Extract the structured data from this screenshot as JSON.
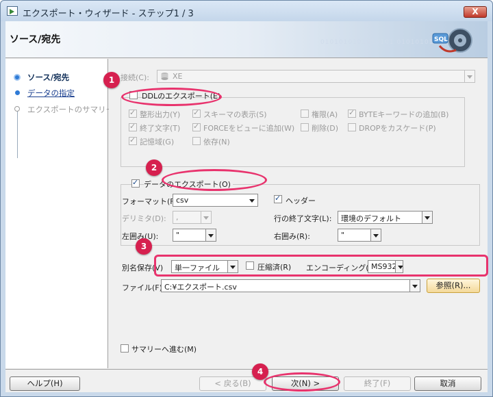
{
  "window": {
    "title": "エクスポート・ウィザード - ステップ1 / 3",
    "close_label": "X"
  },
  "header": {
    "title": "ソース/宛先",
    "binary_text": "0101010101010101 01010101010",
    "logo_text": "SQL"
  },
  "nav": {
    "items": [
      {
        "label": "ソース/宛先",
        "state": "current"
      },
      {
        "label": "データの指定",
        "state": "link"
      },
      {
        "label": "エクスポートのサマリー",
        "state": "disabled"
      }
    ]
  },
  "connection": {
    "label": "接続(C):",
    "value": "XE"
  },
  "ddl": {
    "label": "DDLのエクスポート(E)",
    "checked": false,
    "options": [
      {
        "label": "整形出力(Y)",
        "checked": true
      },
      {
        "label": "スキーマの表示(S)",
        "checked": true
      },
      {
        "label": "権限(A)",
        "checked": false
      },
      {
        "label": "BYTEキーワードの追加(B)",
        "checked": true
      },
      {
        "label": "終了文字(T)",
        "checked": true
      },
      {
        "label": "FORCEをビューに追加(W)",
        "checked": true
      },
      {
        "label": "削除(D)",
        "checked": false
      },
      {
        "label": "DROPをカスケード(P)",
        "checked": false
      },
      {
        "label": "記憶域(G)",
        "checked": true
      },
      {
        "label": "依存(N)",
        "checked": false
      }
    ]
  },
  "data_export": {
    "label": "データのエクスポート(O)",
    "checked": true,
    "format_label": "フォーマット(F):",
    "format_value": "csv",
    "header_label": "ヘッダー",
    "header_checked": true,
    "delimiter_label": "デリミタ(D):",
    "delimiter_value": ",",
    "line_term_label": "行の終了文字(L):",
    "line_term_value": "環境のデフォルト",
    "left_enclosure_label": "左囲み(U):",
    "left_enclosure_value": "\"",
    "right_enclosure_label": "右囲み(R):",
    "right_enclosure_value": "\""
  },
  "output": {
    "save_as_label": "別名保存(V)",
    "save_as_value": "単一ファイル",
    "compress_label": "圧縮済(R)",
    "compress_checked": false,
    "encoding_label": "エンコーディング(I):",
    "encoding_value": "MS932",
    "file_label": "ファイル(F):",
    "file_value": "C:¥エクスポート.csv",
    "browse_label": "参照(R)..."
  },
  "summary": {
    "label": "サマリーへ進む(M)",
    "checked": false
  },
  "footer": {
    "help": "ヘルプ(H)",
    "back": "< 戻る(B)",
    "next": "次(N) >",
    "finish": "終了(F)",
    "cancel": "取消"
  },
  "annotations": {
    "badges": [
      "1",
      "2",
      "3",
      "4"
    ],
    "color": "#e8336d"
  }
}
